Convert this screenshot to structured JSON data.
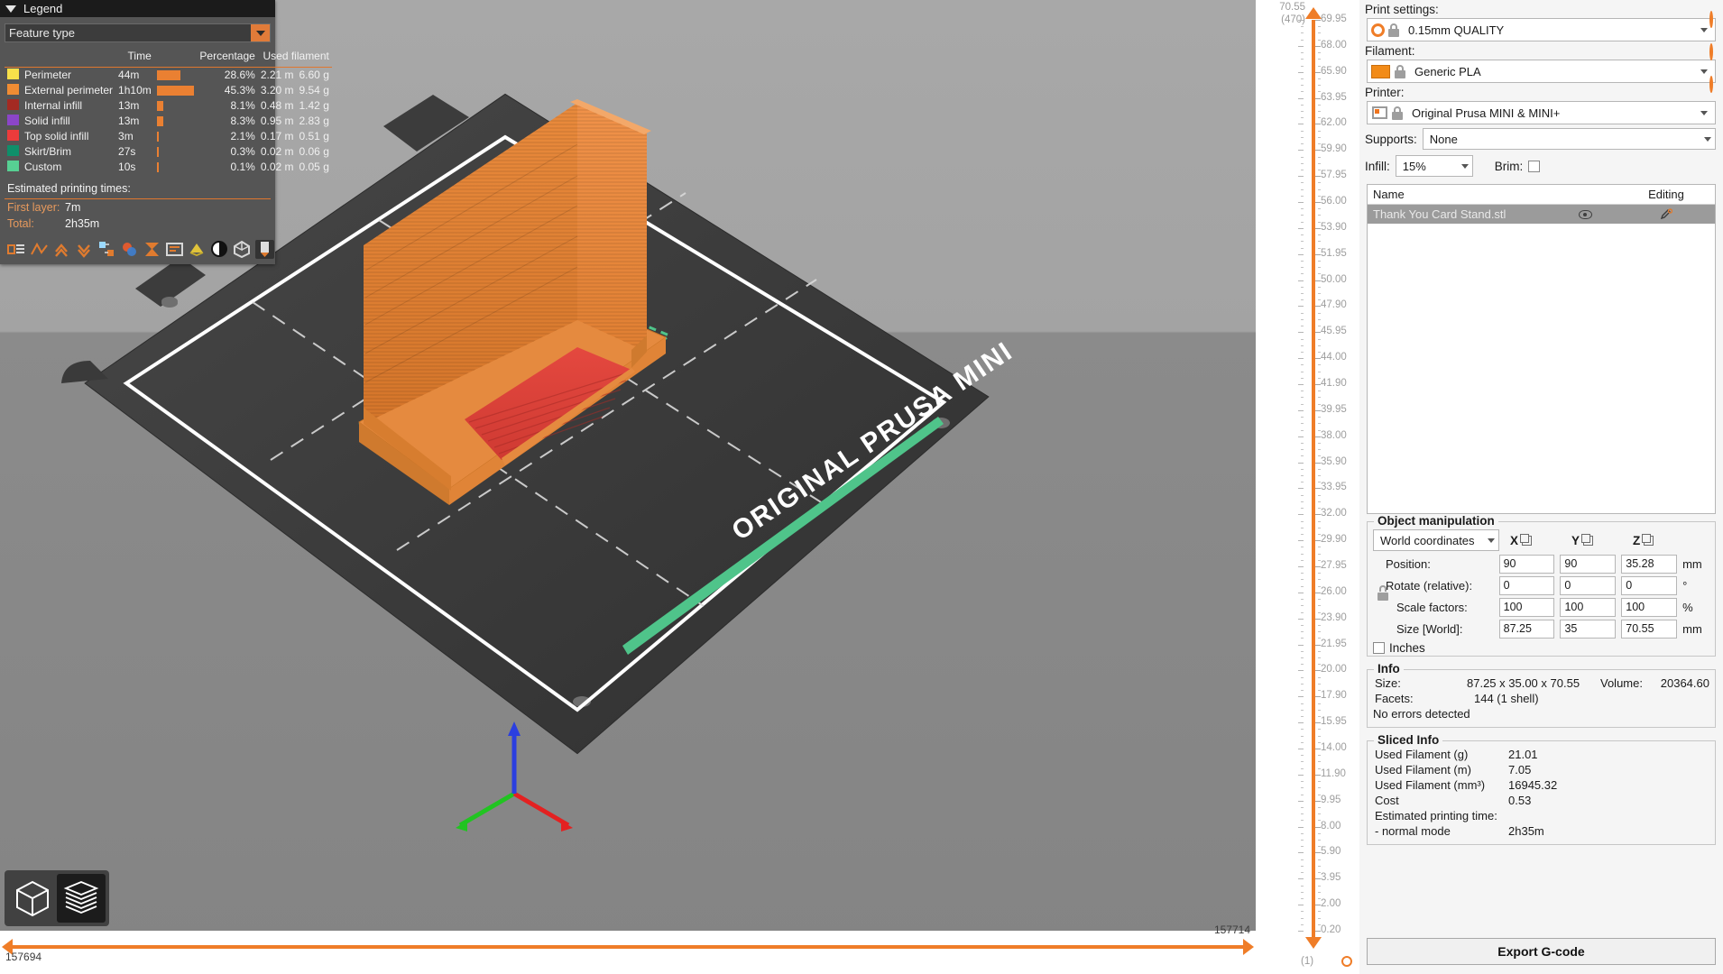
{
  "legend": {
    "title": "Legend",
    "view_type": "Feature type",
    "columns": [
      "",
      "",
      "Time",
      "Percentage",
      "Used filament",
      ""
    ],
    "rows": [
      {
        "color": "#f7e04a",
        "name": "Perimeter",
        "time": "44m",
        "bar_pct": 28.6,
        "percentage": "28.6%",
        "length": "2.21 m",
        "weight": "6.60 g"
      },
      {
        "color": "#f08c33",
        "name": "External perimeter",
        "time": "1h10m",
        "bar_pct": 45.3,
        "percentage": "45.3%",
        "length": "3.20 m",
        "weight": "9.54 g"
      },
      {
        "color": "#a42a22",
        "name": "Internal infill",
        "time": "13m",
        "bar_pct": 8.1,
        "percentage": "8.1%",
        "length": "0.48 m",
        "weight": "1.42 g"
      },
      {
        "color": "#8b45c8",
        "name": "Solid infill",
        "time": "13m",
        "bar_pct": 8.3,
        "percentage": "8.3%",
        "length": "0.95 m",
        "weight": "2.83 g"
      },
      {
        "color": "#ec3b3b",
        "name": "Top solid infill",
        "time": "3m",
        "bar_pct": 2.1,
        "percentage": "2.1%",
        "length": "0.17 m",
        "weight": "0.51 g"
      },
      {
        "color": "#0f8f6a",
        "name": "Skirt/Brim",
        "time": "27s",
        "bar_pct": 0.3,
        "percentage": "0.3%",
        "length": "0.02 m",
        "weight": "0.06 g"
      },
      {
        "color": "#57d093",
        "name": "Custom",
        "time": "10s",
        "bar_pct": 0.1,
        "percentage": "0.1%",
        "length": "0.02 m",
        "weight": "0.05 g"
      }
    ],
    "estimated_title": "Estimated printing times:",
    "first_layer_label": "First layer:",
    "first_layer_value": "7m",
    "total_label": "Total:",
    "total_value": "2h35m",
    "toolbar_icons": [
      "legend-view-icon",
      "travel-icon",
      "retractions-icon",
      "deretractions-icon",
      "tool-changes-icon",
      "color-changes-icon",
      "pause-prints-icon",
      "custom-gcodes-icon",
      "shells-icon",
      "legend-toggle-icon",
      "sequential-icon",
      "tool-marker-icon"
    ]
  },
  "viewport": {
    "bed_label": "ORIGINAL PRUSA MINI",
    "view_toggle": {
      "three_d": "3D editor view",
      "preview": "Preview",
      "active": "preview"
    },
    "axes": {
      "x": "X",
      "y": "Y",
      "z": "Z"
    }
  },
  "h_slider": {
    "left_value": "157694",
    "right_value": "157714"
  },
  "v_slider": {
    "top_value": "70.55",
    "top_layer": "(470)",
    "bottom_layer": "(1)",
    "ticks": [
      "69.95",
      "68.00",
      "65.90",
      "63.95",
      "62.00",
      "59.90",
      "57.95",
      "56.00",
      "53.90",
      "51.95",
      "50.00",
      "47.90",
      "45.95",
      "44.00",
      "41.90",
      "39.95",
      "38.00",
      "35.90",
      "33.95",
      "32.00",
      "29.90",
      "27.95",
      "26.00",
      "23.90",
      "21.95",
      "20.00",
      "17.90",
      "15.95",
      "14.00",
      "11.90",
      "9.95",
      "8.00",
      "5.90",
      "3.95",
      "2.00",
      "0.20"
    ]
  },
  "sidebar": {
    "print_settings": {
      "label": "Print settings:",
      "value": "0.15mm QUALITY"
    },
    "filament": {
      "label": "Filament:",
      "value": "Generic PLA",
      "color": "#f28b18"
    },
    "printer": {
      "label": "Printer:",
      "value": "Original Prusa MINI & MINI+"
    },
    "supports": {
      "label": "Supports:",
      "value": "None"
    },
    "infill": {
      "label": "Infill:",
      "value": "15%"
    },
    "brim": {
      "label": "Brim:",
      "checked": false
    },
    "object_list": {
      "columns": [
        "Name",
        "",
        "Editing"
      ],
      "rows": [
        {
          "name": "Thank You Card Stand.stl",
          "visible": true
        }
      ]
    },
    "manipulation": {
      "title": "Object manipulation",
      "coordinate_system": "World coordinates",
      "axes": [
        "X",
        "Y",
        "Z"
      ],
      "rows": [
        {
          "label": "Position:",
          "x": "90",
          "y": "90",
          "z": "35.28",
          "unit": "mm"
        },
        {
          "label": "Rotate (relative):",
          "x": "0",
          "y": "0",
          "z": "0",
          "unit": "°"
        },
        {
          "label": "Scale factors:",
          "x": "100",
          "y": "100",
          "z": "100",
          "unit": "%"
        },
        {
          "label": "Size [World]:",
          "x": "87.25",
          "y": "35",
          "z": "70.55",
          "unit": "mm"
        }
      ],
      "inches_label": "Inches",
      "inches_checked": false
    },
    "info": {
      "title": "Info",
      "size_label": "Size:",
      "size_value": "87.25 x 35.00 x 70.55",
      "volume_label": "Volume:",
      "volume_value": "20364.60",
      "facets_label": "Facets:",
      "facets_value": "144 (1 shell)",
      "errors": "No errors detected"
    },
    "sliced_info": {
      "title": "Sliced Info",
      "rows": [
        {
          "label": "Used Filament (g)",
          "value": "21.01"
        },
        {
          "label": "Used Filament (m)",
          "value": "7.05"
        },
        {
          "label": "Used Filament (mm³)",
          "value": "16945.32"
        },
        {
          "label": "Cost",
          "value": "0.53"
        },
        {
          "label": "Estimated printing time:",
          "value": ""
        },
        {
          "label": " - normal mode",
          "value": "2h35m"
        }
      ]
    },
    "export_button": "Export G-code"
  }
}
